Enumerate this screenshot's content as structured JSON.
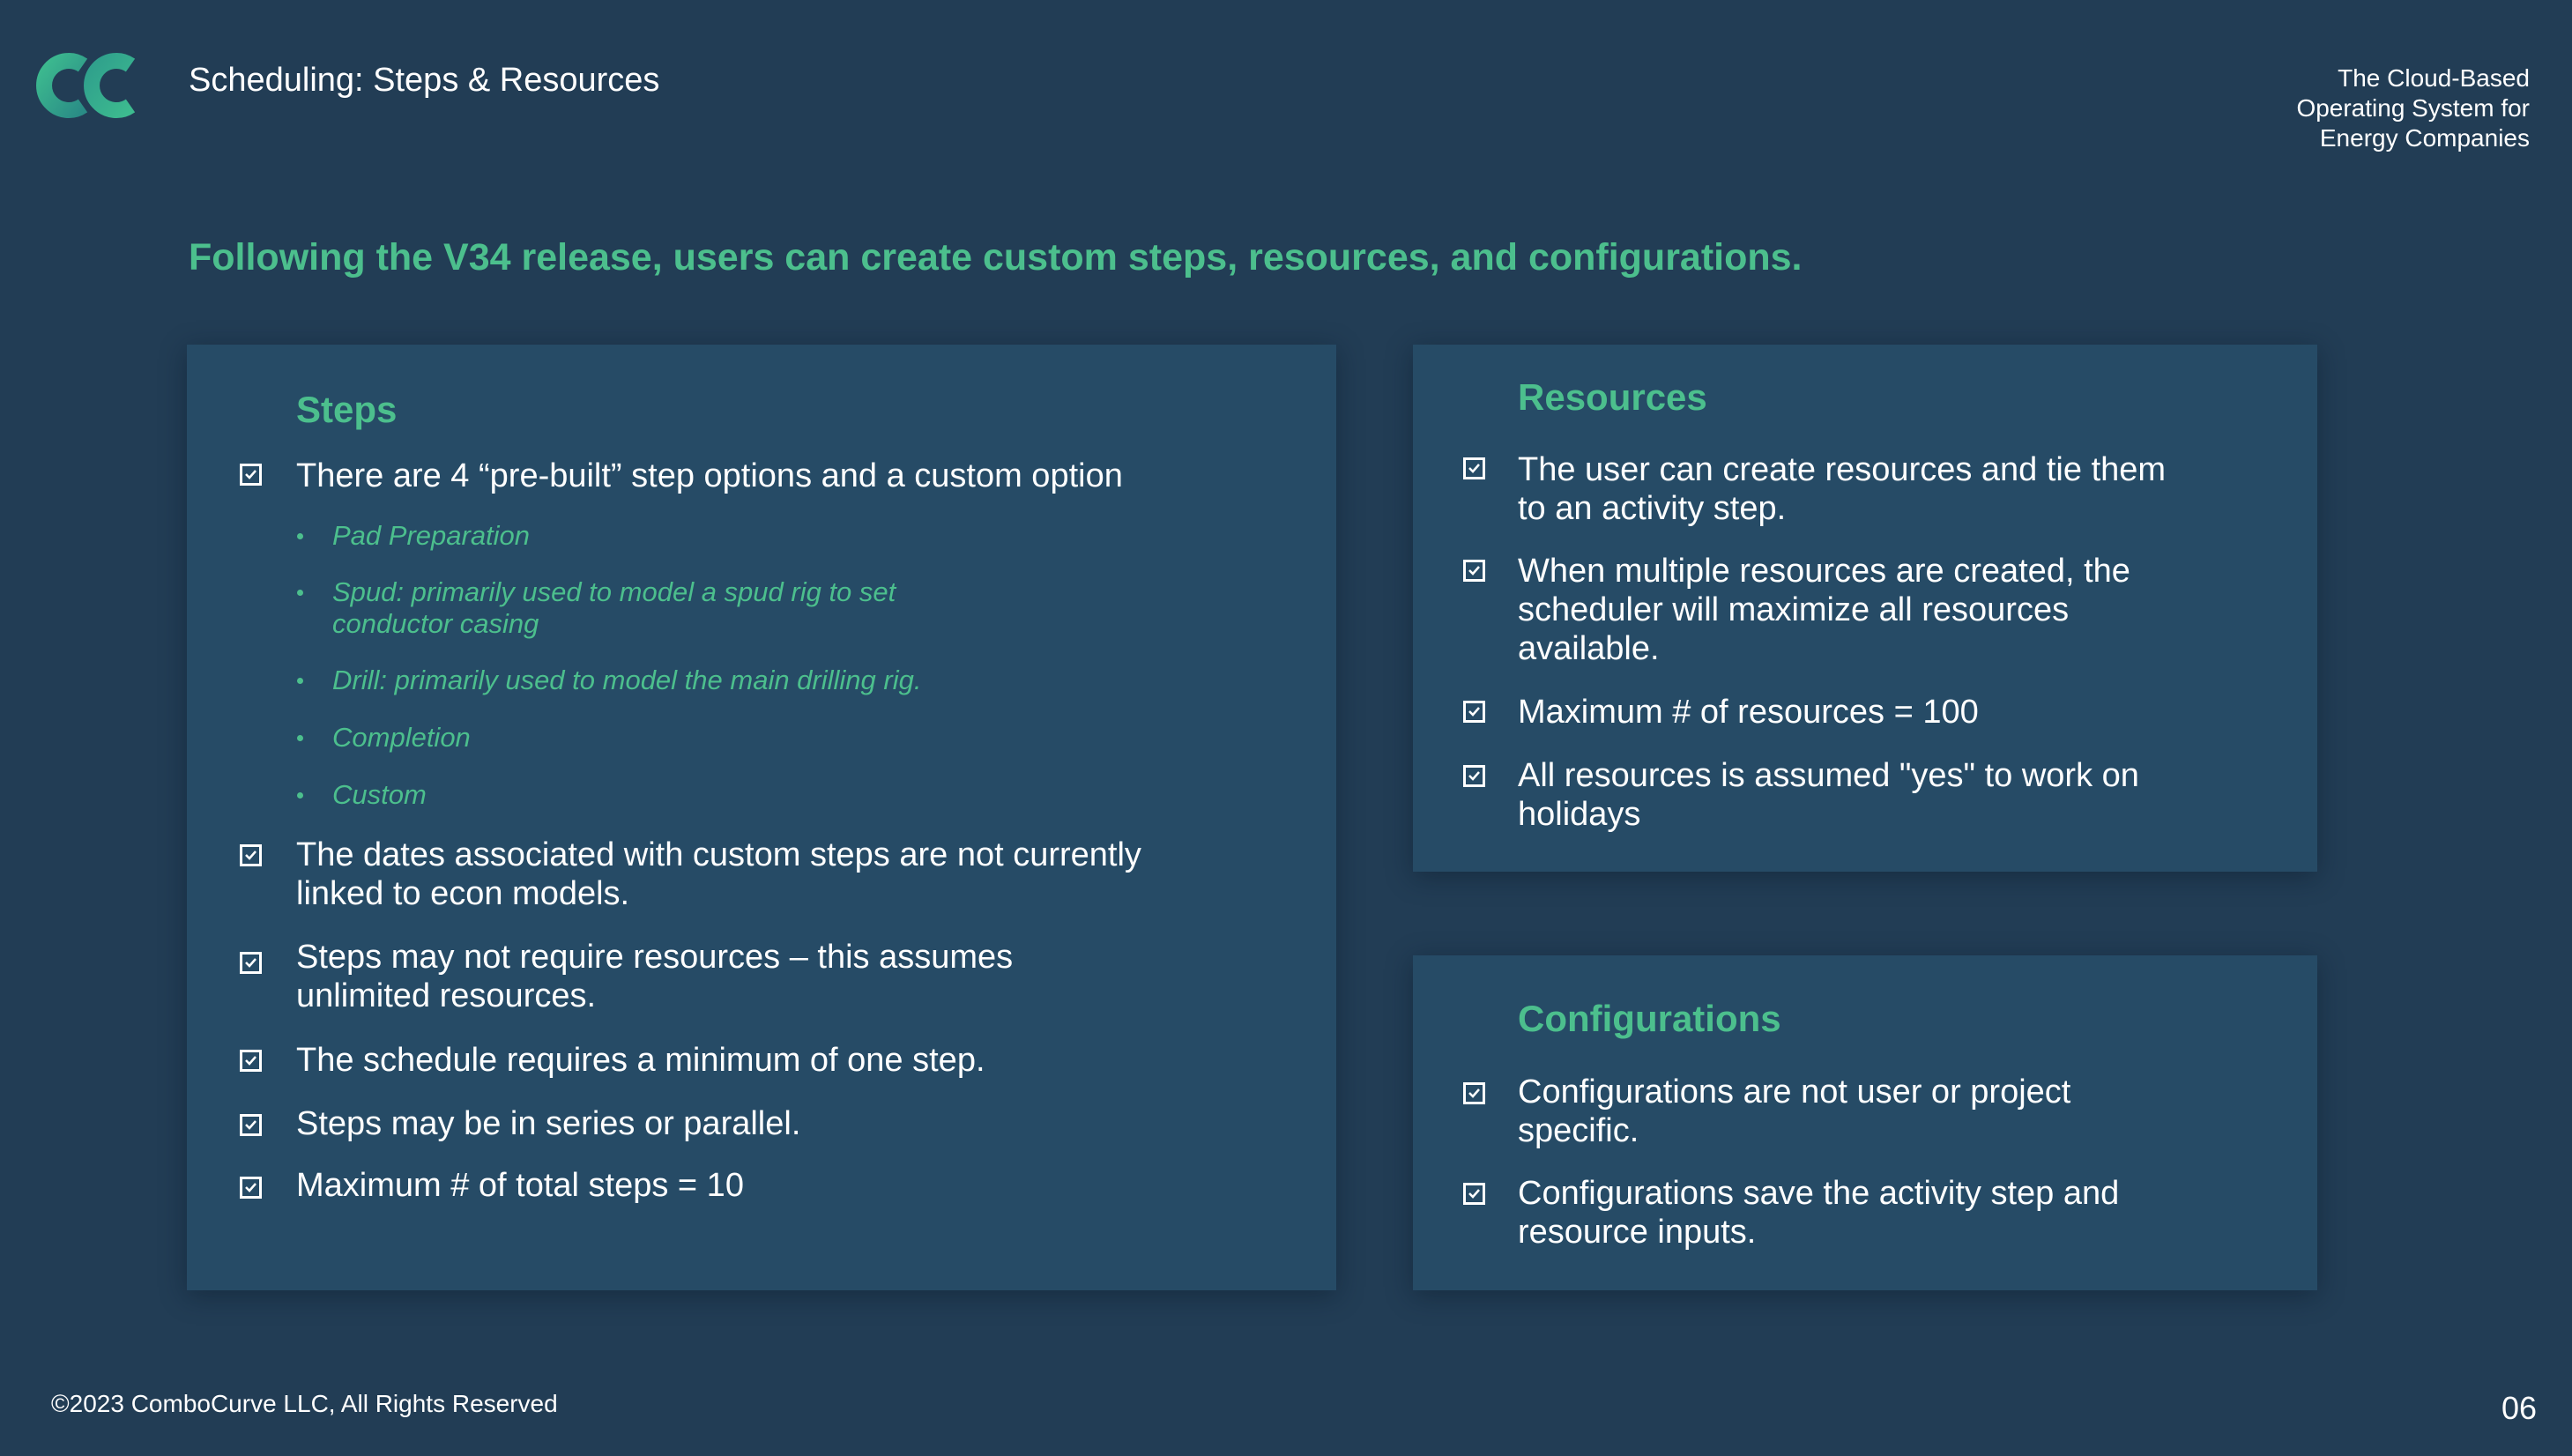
{
  "header": {
    "logo_icon": "combocurve-logo-icon",
    "title": "Scheduling: Steps & Resources",
    "tagline": [
      "The Cloud-Based",
      "Operating System for",
      "Energy Companies"
    ]
  },
  "headline": "Following the V34 release, users can create custom steps, resources, and configurations.",
  "steps": {
    "heading": "Steps",
    "items": [
      {
        "lines": [
          "There are 4 “pre-built” step options and a custom option"
        ]
      },
      {
        "lines": [
          "The dates associated with custom steps are not currently",
          "linked to econ models."
        ]
      },
      {
        "lines": [
          "Steps may not require resources – this assumes",
          "unlimited resources."
        ]
      },
      {
        "lines": [
          "The schedule requires a minimum of one step."
        ]
      },
      {
        "lines": [
          "Steps may be in series or parallel."
        ]
      },
      {
        "lines": [
          "Maximum # of total steps = 10"
        ]
      }
    ],
    "sub_items": [
      {
        "lines": [
          "Pad Preparation"
        ]
      },
      {
        "lines": [
          "Spud: primarily used to model a spud rig to set",
          "conductor casing"
        ]
      },
      {
        "lines": [
          "Drill: primarily used to model the main drilling rig."
        ]
      },
      {
        "lines": [
          "Completion"
        ]
      },
      {
        "lines": [
          "Custom"
        ]
      }
    ]
  },
  "resources": {
    "heading": "Resources",
    "items": [
      {
        "lines": [
          "The user can create resources and tie them",
          "to an activity step."
        ]
      },
      {
        "lines": [
          "When multiple resources are created, the",
          "scheduler will maximize all resources",
          "available."
        ]
      },
      {
        "lines": [
          "Maximum # of resources = 100"
        ]
      },
      {
        "lines": [
          "All resources is assumed \"yes\" to work on",
          "holidays"
        ]
      }
    ]
  },
  "configurations": {
    "heading": "Configurations",
    "items": [
      {
        "lines": [
          "Configurations are not user or project",
          "specific."
        ]
      },
      {
        "lines": [
          "Configurations save the activity step and",
          "resource inputs."
        ]
      }
    ]
  },
  "footer": {
    "copyright": "©2023 ComboCurve LLC, All Rights Reserved",
    "page_number": "06"
  },
  "colors": {
    "background": "#223d55",
    "panel": "#264b66",
    "accent_green": "#4cbf8d",
    "text": "#ffffff"
  }
}
